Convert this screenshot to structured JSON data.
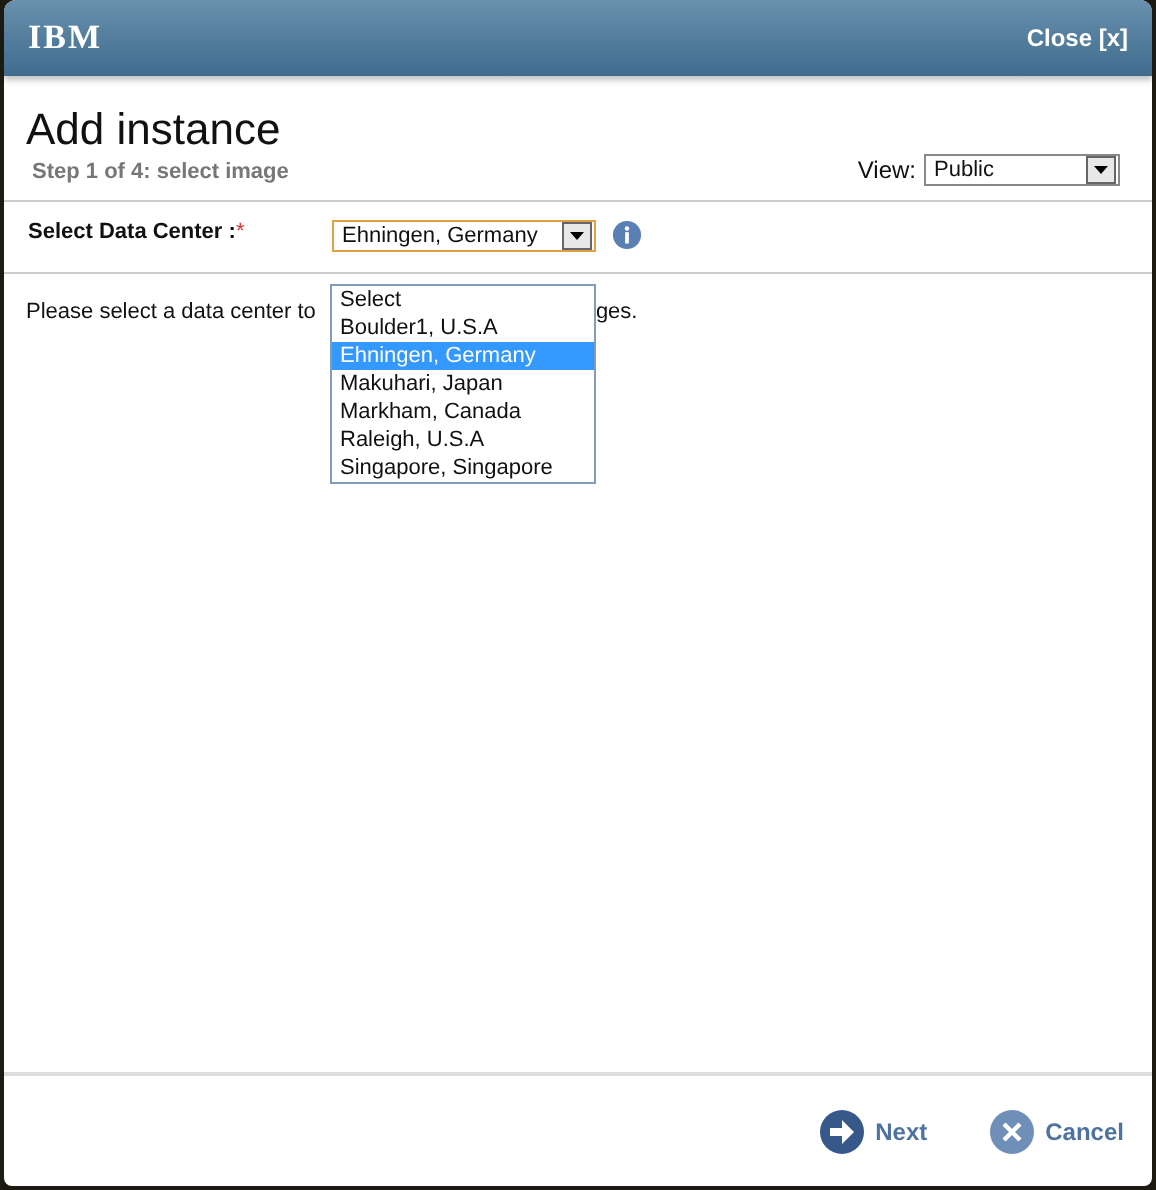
{
  "header": {
    "logo": "IBM",
    "close": "Close [x]"
  },
  "title": "Add instance",
  "step": "Step 1 of 4: select image",
  "view": {
    "label": "View:",
    "value": "Public"
  },
  "data_center": {
    "label": "Select Data Center :",
    "required_mark": "*",
    "value": "Ehningen, Germany",
    "expanded": true,
    "options": [
      {
        "label": "Select",
        "selected": false
      },
      {
        "label": "Boulder1, U.S.A",
        "selected": false
      },
      {
        "label": "Ehningen, Germany",
        "selected": true
      },
      {
        "label": "Makuhari, Japan",
        "selected": false
      },
      {
        "label": "Markham, Canada",
        "selected": false
      },
      {
        "label": "Raleigh, U.S.A",
        "selected": false
      },
      {
        "label": "Singapore, Singapore",
        "selected": false
      }
    ]
  },
  "message": {
    "visible_start": "Please select a data center to",
    "visible_end": "ges."
  },
  "buttons": [
    {
      "kind": "next",
      "label": "Next"
    },
    {
      "kind": "cancel",
      "label": "Cancel"
    }
  ]
}
